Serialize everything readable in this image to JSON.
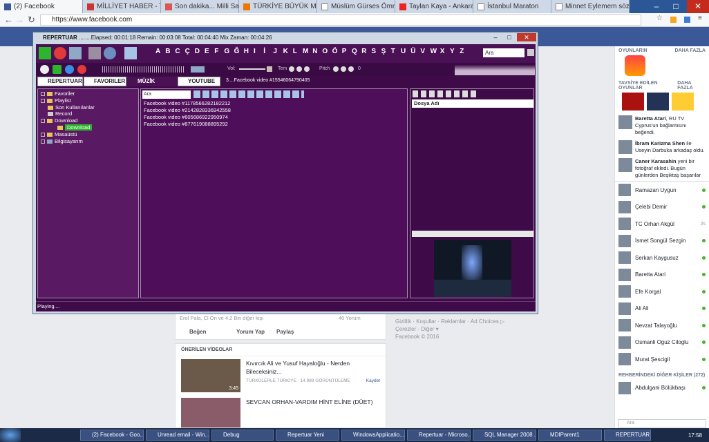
{
  "browser": {
    "tabs": [
      "(2) Facebook",
      "MİLLİYET HABER - TÜ",
      "Son dakika... Milli Sav",
      "TÜRKİYE BÜYÜK MİLLİ",
      "Müslüm Gürses Ömrü",
      "Taylan Kaya - Ankara",
      "İstanbul Maraton",
      "Minnet Eylemem sözle"
    ],
    "url": "https://www.facebook.com"
  },
  "app": {
    "title": "REPERTUAR",
    "times": "........Elapsed: 00:01:18 Remain: 00:03:08 Total: 00:04:40 Mix Zaman: 00:04:26",
    "letters": [
      "A",
      "B",
      "C",
      "Ç",
      "D",
      "E",
      "F",
      "G",
      "Ğ",
      "H",
      "I",
      "İ",
      "J",
      "K",
      "L",
      "M",
      "N",
      "O",
      "Ö",
      "P",
      "Q",
      "R",
      "S",
      "Ş",
      "T",
      "U",
      "Ü",
      "V",
      "W",
      "X",
      "Y",
      "Z"
    ],
    "search_placeholder": "Ara",
    "vol": "Vol:",
    "tem": "Tem",
    "pitch": "Pitch",
    "pitch_val": "0",
    "tabs": [
      "REPERTUAR",
      "FAVORILER",
      "MÜZİK",
      "YOUTUBE"
    ],
    "now_playing": "3....Facebook video #15546064790405",
    "tree": [
      "Favoriler",
      "Playlist",
      "Son Kullanılanlar",
      "Record",
      "Download",
      "Download",
      "Masaüstü",
      "Bilgisayarım"
    ],
    "list_search": "Ara",
    "videos": [
      "Facebook video #1178566282182212",
      "Facebook video #2142828336942558",
      "Facebook video #605686922950974",
      "Facebook video #877619088895292"
    ],
    "dosya": "Dosya Adı",
    "status": "Playing...."
  },
  "fb": {
    "reactions": "Erol Pala, Cl On ve 4.2 Bin diğer kişi",
    "comments": "40 Yorum",
    "like": "Beğen",
    "comment": "Yorum Yap",
    "share": "Paylaş",
    "suggested": "ÖNERİLEN VİDEOLAR",
    "v1_title": "Kıvırcık Ali ve Yusuf Hayaloğlu - Nerden Bileceksiniz...",
    "v1_meta": "TÜRKÜLERLE TÜRKİYE · 14.989 GÖRÜNTÜLEME",
    "v1_dur": "3:45",
    "save": "Kaydet",
    "v2_title": "SEVCAN ORHAN-VARDIM HİNT ELİNE (DÜET)",
    "footer1": "Gizlilik · Koşullar · Reklamlar · Ad Choices ▷",
    "footer2": "Çerezler · Diğer ▾",
    "footer3": "Facebook © 2016"
  },
  "right": {
    "games": "OYUNLARIN",
    "more": "DAHA FAZLA",
    "suggested_games": "TAVSİYE EDİLEN OYUNLAR",
    "feed": [
      {
        "name": "Baretta Atari",
        "text": ", RU TV Cyprus'un bağlantısını beğendi."
      },
      {
        "name": "İbram Karizma Shen",
        "text": " ile Useyin Darbuka arkadaş oldu."
      },
      {
        "name": "Caner Karasahin",
        "text": " yeni bir fotoğraf ekledi. Bugün günlerden Beşiktaş başarılar kardaşım —"
      }
    ],
    "contacts": [
      "Ramazan Uygun",
      "Çelebi Demir",
      "TC Orhan Akgül",
      "İsmet Songül Sezgin",
      "Serkan Kaygusuz",
      "Baretta Atari",
      "Efe Korgal",
      "Ali Ali",
      "Nevzat Talayoğlu",
      "Osmanli Oguz Ciloglu",
      "Murat Şescigil"
    ],
    "contact_extra": "2s",
    "others": "REHBERİNDEKİ DİĞER KİŞİLER (272)",
    "last": "Abdulgani Bölükbaşı",
    "search": "Ara"
  },
  "taskbar": {
    "items": [
      "(2) Facebook - Goo...",
      "Unread email - Win...",
      "Debug",
      "Repertuar Yeni",
      "WindowsApplicatio...",
      "Repertuar - Microso...",
      "SQL Manager 2008 ...",
      "MDIParent1",
      "REPERTUAR"
    ],
    "clock": "17:58"
  }
}
